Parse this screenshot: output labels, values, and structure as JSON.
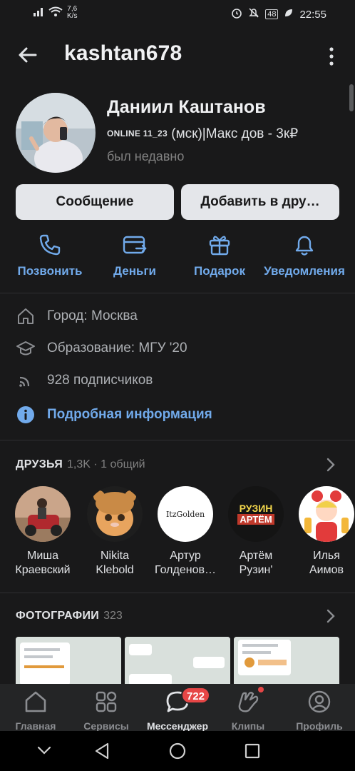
{
  "status_bar": {
    "net_speed_value": "7,6",
    "net_speed_unit": "K/s",
    "battery": "48",
    "time": "22:55"
  },
  "header": {
    "title": "kashtan678"
  },
  "profile": {
    "name": "Даниил Каштанов",
    "status_prefix": "ONLINE 11_23",
    "status_rest": " (мск)|Макс дов - 3к₽",
    "last_seen": "был недавно"
  },
  "buttons": {
    "message": "Сообщение",
    "add_friend": "Добавить в дру…"
  },
  "actions": [
    {
      "label": "Позвонить",
      "icon": "phone-icon"
    },
    {
      "label": "Деньги",
      "icon": "money-transfer-icon"
    },
    {
      "label": "Подарок",
      "icon": "gift-icon"
    },
    {
      "label": "Уведомления",
      "icon": "bell-icon"
    }
  ],
  "info": {
    "city": "Город: Москва",
    "education": "Образование: МГУ '20",
    "followers": "928 подписчиков",
    "details": "Подробная информация"
  },
  "friends": {
    "title": "ДРУЗЬЯ",
    "count": "1,3K · 1 общий",
    "items": [
      {
        "line1": "Миша",
        "line2": "Краевский"
      },
      {
        "line1": "Nikita",
        "line2": "Klebold"
      },
      {
        "line1": "Артур",
        "line2": "Голденов…",
        "avatar_text": "ItzGolden"
      },
      {
        "line1": "Артём",
        "line2": "Рузин'",
        "avatar_text_1": "РУЗИН",
        "avatar_text_2": "АРТЁМ"
      },
      {
        "line1": "Илья",
        "line2": "Аимов"
      }
    ]
  },
  "photos": {
    "title": "ФОТОГРАФИИ",
    "count": "323"
  },
  "tabbar": {
    "home": "Главная",
    "services": "Сервисы",
    "messenger": "Мессенджер",
    "messenger_badge": "722",
    "clips": "Клипы",
    "profile": "Профиль"
  },
  "colors": {
    "background": "#19191a",
    "accent": "#71aaeb",
    "badge": "#e64646",
    "button": "#e4e6ea"
  }
}
